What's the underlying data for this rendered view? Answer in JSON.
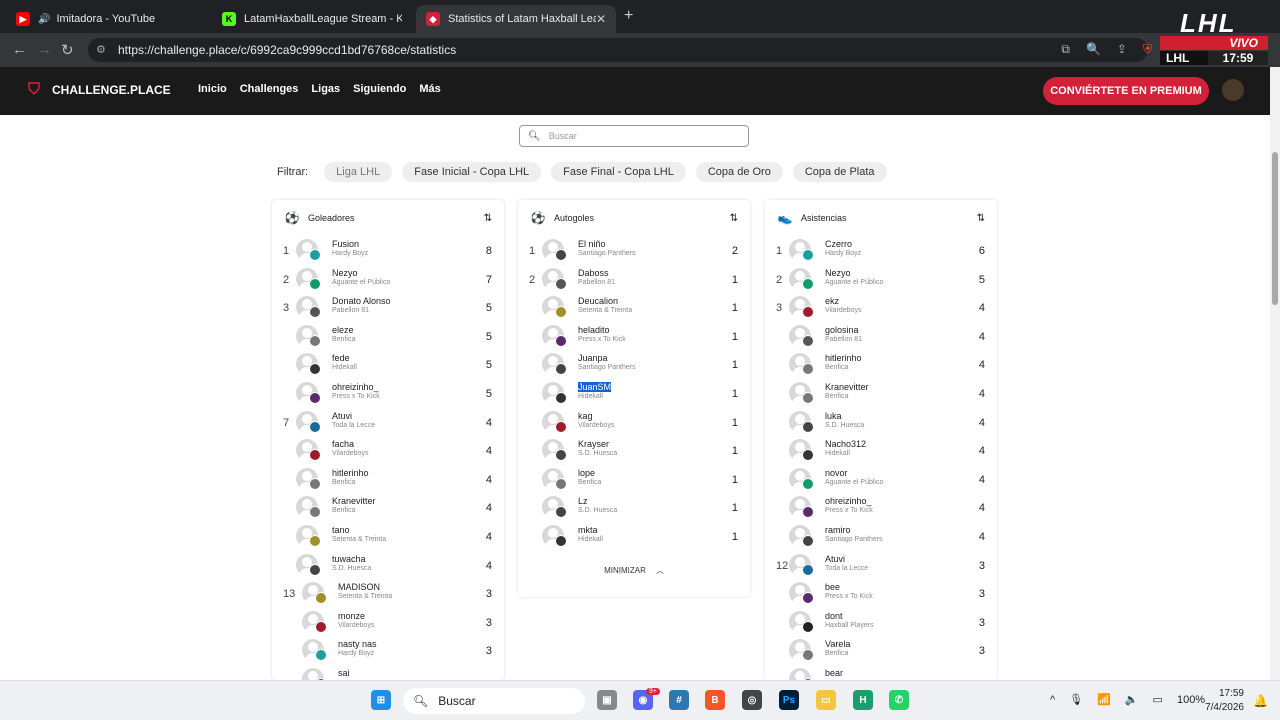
{
  "browser": {
    "tabs": [
      {
        "title": "Imitadora - YouTube",
        "fav_color": "#ff0000"
      },
      {
        "title": "LatamHaxballLeague Stream - Kick D",
        "fav_color": "#53fc18"
      },
      {
        "title": "Statistics of Latam Haxball League",
        "fav_color": "#d4213a"
      }
    ],
    "url": "https://challenge.place/c/6992ca9c999ccd1bd76768ce/statistics"
  },
  "overlay": {
    "logo": "LHL",
    "live": "VIVO",
    "tag": "LHL",
    "time": "17:59"
  },
  "site": {
    "brand": "CHALLENGE.PLACE",
    "nav": [
      "Inicio",
      "Challenges",
      "Ligas",
      "Siguiendo",
      "Más"
    ],
    "premium": "CONVIÉRTETE EN PREMIUM",
    "search_placeholder": "Buscar",
    "filter_label": "Filtrar:",
    "filters": [
      "Liga LHL",
      "Fase Inicial - Copa LHL",
      "Fase Final - Copa LHL",
      "Copa de Oro",
      "Copa de Plata"
    ],
    "cards": [
      {
        "title": "Goleadores",
        "rows": [
          {
            "rank": "1",
            "name": "Fusion",
            "team": "Hardy Boyz",
            "value": "8",
            "badge": "#1aa0a0"
          },
          {
            "rank": "2",
            "name": "Nezyo",
            "team": "Aguante el Público",
            "value": "7",
            "badge": "#0e9c6a"
          },
          {
            "rank": "3",
            "name": "Donato Alonso",
            "team": "Pabellon 81",
            "value": "5",
            "badge": "#555"
          },
          {
            "rank": "",
            "name": "eleze",
            "team": "Benfica",
            "value": "5",
            "badge": "#777"
          },
          {
            "rank": "",
            "name": "fede",
            "team": "Hidekall",
            "value": "5",
            "badge": "#333"
          },
          {
            "rank": "",
            "name": "ohreizinho_",
            "team": "Press x To Kick",
            "value": "5",
            "badge": "#5a2a6a"
          },
          {
            "rank": "7",
            "name": "Atuvi",
            "team": "Toda la Lecce",
            "value": "4",
            "badge": "#1a6a9a"
          },
          {
            "rank": "",
            "name": "facha",
            "team": "Vilardeboys",
            "value": "4",
            "badge": "#a01a2a"
          },
          {
            "rank": "",
            "name": "hitlerinho",
            "team": "Benfica",
            "value": "4",
            "badge": "#777"
          },
          {
            "rank": "",
            "name": "Kranevitter",
            "team": "Benfica",
            "value": "4",
            "badge": "#777"
          },
          {
            "rank": "",
            "name": "tano",
            "team": "Setenta & Treinta",
            "value": "4",
            "badge": "#a0902a"
          },
          {
            "rank": "",
            "name": "tuwacha",
            "team": "S.D. Huesca",
            "value": "4",
            "badge": "#444"
          },
          {
            "rank": "13",
            "name": "MADISON",
            "team": "Setenta & Treinta",
            "value": "3",
            "badge": "#a0902a"
          },
          {
            "rank": "",
            "name": "monze",
            "team": "Vilardeboys",
            "value": "3",
            "badge": "#a01a2a"
          },
          {
            "rank": "",
            "name": "nasty nas",
            "team": "Hardy Boyz",
            "value": "3",
            "badge": "#1aa0a0"
          },
          {
            "rank": "",
            "name": "sai",
            "team": "",
            "value": "",
            "badge": "#555"
          }
        ]
      },
      {
        "title": "Autogoles",
        "rows": [
          {
            "rank": "1",
            "name": "El niño",
            "team": "Santiago Panthers",
            "value": "2",
            "badge": "#444"
          },
          {
            "rank": "2",
            "name": "Daboss",
            "team": "Pabellon 81",
            "value": "1",
            "badge": "#555"
          },
          {
            "rank": "",
            "name": "Deucalion",
            "team": "Setenta & Treinta",
            "value": "1",
            "badge": "#a0902a"
          },
          {
            "rank": "",
            "name": "heladito",
            "team": "Press x To Kick",
            "value": "1",
            "badge": "#5a2a6a"
          },
          {
            "rank": "",
            "name": "Juanpa",
            "team": "Santiago Panthers",
            "value": "1",
            "badge": "#444"
          },
          {
            "rank": "",
            "name": "JuanSM",
            "team": "Hidekall",
            "value": "1",
            "badge": "#333",
            "selected": true
          },
          {
            "rank": "",
            "name": "kag",
            "team": "Vilardeboys",
            "value": "1",
            "badge": "#a01a2a"
          },
          {
            "rank": "",
            "name": "Krayser",
            "team": "S.D. Huesca",
            "value": "1",
            "badge": "#444"
          },
          {
            "rank": "",
            "name": "lope",
            "team": "Benfica",
            "value": "1",
            "badge": "#777"
          },
          {
            "rank": "",
            "name": "Lz",
            "team": "S.D. Huesca",
            "value": "1",
            "badge": "#444"
          },
          {
            "rank": "",
            "name": "mkta",
            "team": "Hidekall",
            "value": "1",
            "badge": "#333"
          }
        ],
        "minimize": "MINIMIZAR"
      },
      {
        "title": "Asistencias",
        "rows": [
          {
            "rank": "1",
            "name": "Czerro",
            "team": "Hardy Boyz",
            "value": "6",
            "badge": "#1aa0a0"
          },
          {
            "rank": "2",
            "name": "Nezyo",
            "team": "Aguante el Público",
            "value": "5",
            "badge": "#0e9c6a"
          },
          {
            "rank": "3",
            "name": "ekz",
            "team": "Vilardeboys",
            "value": "4",
            "badge": "#a01a2a"
          },
          {
            "rank": "",
            "name": "golosina",
            "team": "Pabellon 81",
            "value": "4",
            "badge": "#555"
          },
          {
            "rank": "",
            "name": "hitlerinho",
            "team": "Benfica",
            "value": "4",
            "badge": "#777"
          },
          {
            "rank": "",
            "name": "Kranevitter",
            "team": "Benfica",
            "value": "4",
            "badge": "#777"
          },
          {
            "rank": "",
            "name": "luka",
            "team": "S.D. Huesca",
            "value": "4",
            "badge": "#444"
          },
          {
            "rank": "",
            "name": "Nacho312",
            "team": "Hidekall",
            "value": "4",
            "badge": "#333"
          },
          {
            "rank": "",
            "name": "novor",
            "team": "Aguante el Público",
            "value": "4",
            "badge": "#0e9c6a"
          },
          {
            "rank": "",
            "name": "ohreizinho_",
            "team": "Press x To Kick",
            "value": "4",
            "badge": "#5a2a6a"
          },
          {
            "rank": "",
            "name": "ramiro",
            "team": "Santiago Panthers",
            "value": "4",
            "badge": "#444"
          },
          {
            "rank": "12",
            "name": "Atuvi",
            "team": "Toda la Lecce",
            "value": "3",
            "badge": "#1a6a9a"
          },
          {
            "rank": "",
            "name": "bee",
            "team": "Press x To Kick",
            "value": "3",
            "badge": "#5a2a6a"
          },
          {
            "rank": "",
            "name": "dont",
            "team": "Haxball Players",
            "value": "3",
            "badge": "#222"
          },
          {
            "rank": "",
            "name": "Varela",
            "team": "Benfica",
            "value": "3",
            "badge": "#777"
          },
          {
            "rank": "",
            "name": "bear",
            "team": "",
            "value": "",
            "badge": "#555"
          }
        ]
      }
    ]
  },
  "taskbar": {
    "search": "Buscar",
    "discord_badge": "9+",
    "battery": "100%",
    "time": "17:59",
    "date": "7/4/2026"
  }
}
